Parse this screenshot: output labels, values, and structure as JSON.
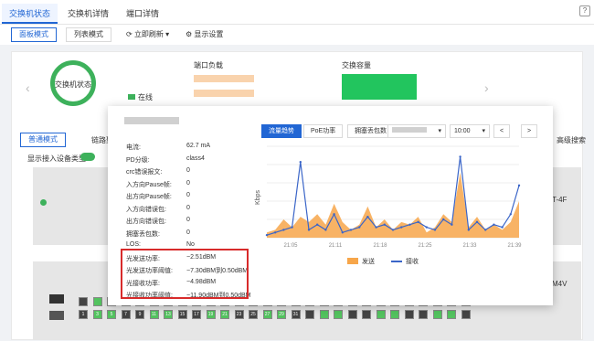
{
  "tabs": [
    "交换机状态",
    "交换机详情",
    "端口详情"
  ],
  "help_label": "?",
  "toolbar": {
    "panel_mode": "面板模式",
    "list_mode": "列表模式",
    "refresh": "立即刷新",
    "display_settings": "显示设置"
  },
  "status": {
    "donut_label": "交换机状态",
    "legend_online": "在线"
  },
  "sections": {
    "port_load": "端口负载",
    "switch_capacity": "交换容量"
  },
  "sub_tabs": {
    "normal": "普通模式",
    "link": "链路聚",
    "advanced_search": "高级搜索",
    "show_device_type": "显示接入设备类型:"
  },
  "device": {
    "suffix1": "T-4F",
    "suffix2": "M4V",
    "ports_top": [
      "",
      "",
      "",
      "",
      "",
      "",
      "",
      "",
      "",
      "",
      "",
      "",
      "",
      "",
      "",
      "",
      "",
      "",
      "",
      "",
      "",
      "",
      "",
      "",
      "",
      "",
      "",
      ""
    ],
    "ports_bottom": [
      "1",
      "3",
      "5",
      "7",
      "9",
      "11",
      "13",
      "15",
      "17",
      "19",
      "21",
      "23",
      "25",
      "27",
      "29",
      "31",
      "",
      "",
      "",
      "",
      "",
      "",
      "",
      "",
      "",
      "",
      "",
      ""
    ],
    "ports_right_top": [
      "26"
    ],
    "ports_right_bottom": [
      "28",
      "30"
    ]
  },
  "popup": {
    "rows": [
      {
        "k": "电流:",
        "v": "62.7 mA"
      },
      {
        "k": "PD分级:",
        "v": "class4"
      },
      {
        "k": "crc错误报文:",
        "v": "0"
      },
      {
        "k": "入方向Pause帧:",
        "v": "0"
      },
      {
        "k": "出方向Pause帧:",
        "v": "0"
      },
      {
        "k": "入方向错误包:",
        "v": "0"
      },
      {
        "k": "出方向错误包:",
        "v": "0"
      },
      {
        "k": "拥塞丢包数:",
        "v": "0"
      },
      {
        "k": "LOS:",
        "v": "No"
      },
      {
        "k": "光发送功率:",
        "v": "−2.51dBM"
      },
      {
        "k": "光发送功率阈值:",
        "v": "−7.30dBM到0.50dBM"
      },
      {
        "k": "光接收功率:",
        "v": "−4.98dBM"
      },
      {
        "k": "光接收功率阈值:",
        "v": "−11.90dBM到0.50dBM"
      }
    ],
    "chart_tabs": [
      "流量趋势",
      "PoE功率",
      "拥塞丢包数"
    ],
    "time_select": "10:00",
    "nav_prev": "<",
    "nav_next": ">"
  },
  "chart_data": {
    "type": "area",
    "ylabel": "Kbps",
    "x_ticks": [
      "21:05",
      "21:11",
      "21:18",
      "21:25",
      "21:33",
      "21:39"
    ],
    "series": [
      {
        "name": "发送",
        "color": "#f7a64a",
        "values": [
          4,
          6,
          14,
          8,
          16,
          12,
          18,
          10,
          26,
          12,
          6,
          10,
          24,
          8,
          14,
          6,
          12,
          10,
          16,
          4,
          8,
          18,
          12,
          50,
          8,
          16,
          6,
          10,
          6,
          12,
          28
        ]
      },
      {
        "name": "接收",
        "color": "#3a65c8",
        "values": [
          2,
          4,
          6,
          8,
          58,
          6,
          10,
          6,
          18,
          4,
          6,
          8,
          16,
          8,
          10,
          6,
          8,
          10,
          12,
          8,
          6,
          14,
          10,
          62,
          6,
          12,
          6,
          10,
          8,
          18,
          40
        ]
      }
    ]
  },
  "colors": {
    "accent": "#2166d4",
    "online": "#3db15b",
    "highlight": "#d82b2b"
  }
}
